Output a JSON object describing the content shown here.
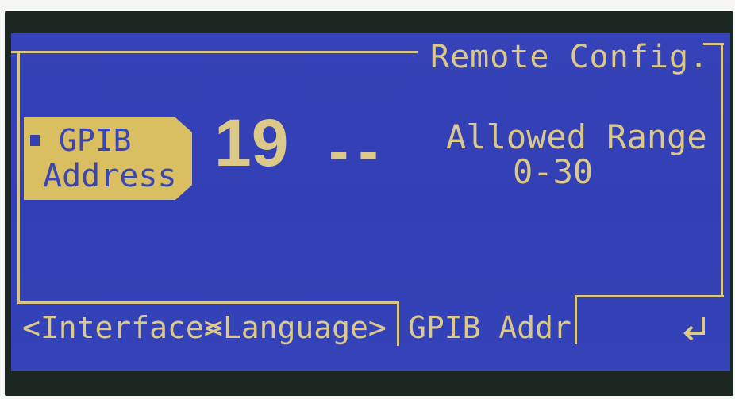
{
  "screen": {
    "title": "Remote Config."
  },
  "field": {
    "label_line1": "GPIB",
    "label_line2": "Address",
    "value": "19",
    "edit_cursor": "--"
  },
  "range": {
    "label": "Allowed Range",
    "value": "0-30"
  },
  "softkeys": {
    "interface": "<Interface>",
    "language": "<Language>",
    "gpib_addr": "GPIB Addr"
  },
  "icons": {
    "enter": "enter-return-icon"
  },
  "colors": {
    "lcd_background": "#3340b5",
    "lcd_text": "#dcc98a",
    "highlight": "#d9bf62"
  }
}
